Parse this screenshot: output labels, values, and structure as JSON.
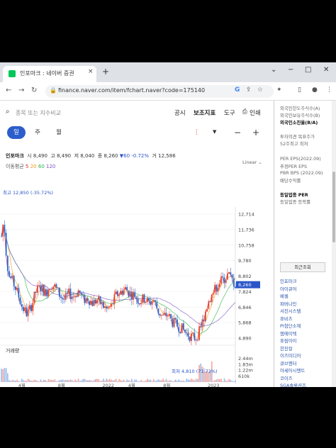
{
  "browser": {
    "tab_title": "인포마크 : 네이버 증권",
    "tab_close": "×",
    "new_tab": "+",
    "url": "finance.naver.com/item/fchart.naver?code=175140",
    "controls": [
      "−",
      "□",
      "✕"
    ]
  },
  "nav": {
    "search_placeholder": "종목 또는 지수비교",
    "items": [
      {
        "label": "공시",
        "active": false
      },
      {
        "label": "보조지표",
        "active": true
      },
      {
        "label": "도구",
        "active": false
      },
      {
        "label": "인쇄",
        "active": false
      }
    ]
  },
  "periods": [
    {
      "label": "일",
      "active": true
    },
    {
      "label": "주",
      "active": false
    },
    {
      "label": "월",
      "active": false
    }
  ],
  "zoom": {
    "minus": "−",
    "plus": "+"
  },
  "stock": {
    "name": "인포마크",
    "open_label": "시",
    "open": "8,490",
    "high_label": "고",
    "high": "8,490",
    "low_label": "저",
    "low": "8,040",
    "close_label": "종",
    "close": "8,260",
    "change": "▼60 -0.72%",
    "volume_label": "거",
    "volume": "12,586"
  },
  "moving_avg": {
    "label": "이동평균",
    "periods": [
      "5",
      "20",
      "60",
      "120"
    ]
  },
  "scale_mode": "Linear",
  "chart_data": {
    "type": "candlestick",
    "price_axis_ticks": [
      "12,714",
      "11,736",
      "10,758",
      "9,780",
      "8,802",
      "7,824",
      "6,846",
      "5,868",
      "4,890"
    ],
    "current_price_label": "8,260",
    "max_annotation": "최고 12,850 (-35.72%)",
    "min_annotation": "최저 4,810 (71.72%)",
    "volume_title": "거래량",
    "volume_ticks": [
      "2.44m",
      "1.83m",
      "1.22m",
      "610k"
    ],
    "x_ticks": [
      "4월",
      "8월",
      "2022",
      "4월",
      "8월",
      "2023"
    ],
    "ylim": [
      4890,
      12714
    ],
    "price_series": [
      {
        "t": 0.0,
        "close": 11300,
        "open": 12200
      },
      {
        "t": 0.01,
        "close": 12400,
        "open": 11300
      },
      {
        "t": 0.02,
        "close": 10300,
        "open": 12400
      },
      {
        "t": 0.03,
        "close": 8900,
        "open": 10300
      },
      {
        "t": 0.05,
        "close": 8400,
        "open": 8900
      },
      {
        "t": 0.07,
        "close": 7700,
        "open": 8400
      },
      {
        "t": 0.09,
        "close": 6800,
        "open": 7700
      },
      {
        "t": 0.11,
        "close": 6400,
        "open": 6800
      },
      {
        "t": 0.13,
        "close": 7000,
        "open": 6400
      },
      {
        "t": 0.15,
        "close": 7900,
        "open": 7000
      },
      {
        "t": 0.17,
        "close": 8100,
        "open": 7900
      },
      {
        "t": 0.19,
        "close": 7700,
        "open": 8100
      },
      {
        "t": 0.21,
        "close": 8300,
        "open": 7700
      },
      {
        "t": 0.23,
        "close": 8100,
        "open": 8300
      },
      {
        "t": 0.25,
        "close": 7600,
        "open": 8100
      },
      {
        "t": 0.27,
        "close": 7300,
        "open": 7600
      },
      {
        "t": 0.29,
        "close": 7700,
        "open": 7300
      },
      {
        "t": 0.31,
        "close": 7500,
        "open": 7700
      },
      {
        "t": 0.33,
        "close": 7900,
        "open": 7500
      },
      {
        "t": 0.35,
        "close": 7300,
        "open": 7900
      },
      {
        "t": 0.37,
        "close": 7400,
        "open": 7300
      },
      {
        "t": 0.39,
        "close": 7100,
        "open": 7400
      },
      {
        "t": 0.41,
        "close": 7300,
        "open": 7100
      },
      {
        "t": 0.43,
        "close": 7000,
        "open": 7300
      },
      {
        "t": 0.45,
        "close": 6700,
        "open": 7000
      },
      {
        "t": 0.47,
        "close": 6900,
        "open": 6700
      },
      {
        "t": 0.49,
        "close": 7600,
        "open": 6900
      },
      {
        "t": 0.51,
        "close": 7800,
        "open": 7600
      },
      {
        "t": 0.53,
        "close": 8000,
        "open": 7800
      },
      {
        "t": 0.55,
        "close": 7700,
        "open": 8000
      },
      {
        "t": 0.57,
        "close": 7600,
        "open": 7700
      },
      {
        "t": 0.59,
        "close": 7200,
        "open": 7600
      },
      {
        "t": 0.61,
        "close": 7400,
        "open": 7200
      },
      {
        "t": 0.63,
        "close": 7100,
        "open": 7400
      },
      {
        "t": 0.65,
        "close": 7300,
        "open": 7100
      },
      {
        "t": 0.67,
        "close": 6600,
        "open": 7300
      },
      {
        "t": 0.69,
        "close": 6200,
        "open": 6600
      },
      {
        "t": 0.71,
        "close": 6400,
        "open": 6200
      },
      {
        "t": 0.73,
        "close": 5900,
        "open": 6400
      },
      {
        "t": 0.75,
        "close": 5700,
        "open": 5900
      },
      {
        "t": 0.77,
        "close": 5500,
        "open": 5700
      },
      {
        "t": 0.79,
        "close": 5200,
        "open": 5500
      },
      {
        "t": 0.81,
        "close": 5000,
        "open": 5200
      },
      {
        "t": 0.83,
        "close": 4900,
        "open": 5000
      },
      {
        "t": 0.85,
        "close": 5400,
        "open": 4900
      },
      {
        "t": 0.87,
        "close": 6500,
        "open": 5400
      },
      {
        "t": 0.89,
        "close": 7400,
        "open": 6500
      },
      {
        "t": 0.91,
        "close": 7900,
        "open": 7400
      },
      {
        "t": 0.93,
        "close": 8400,
        "open": 7900
      },
      {
        "t": 0.95,
        "close": 8600,
        "open": 8400
      },
      {
        "t": 0.97,
        "close": 8900,
        "open": 8600
      },
      {
        "t": 1.0,
        "close": 8260,
        "open": 8900
      }
    ]
  },
  "sidebar": {
    "lines": [
      {
        "text": "외국인한도주식수(A)",
        "style": "gray"
      },
      {
        "text": "외국인보유주식수(B)",
        "style": "gray"
      },
      {
        "text": "외국인소진율(B/A)",
        "style": "bold"
      },
      {
        "text": "투자의견   목표주가",
        "style": "gray"
      },
      {
        "text": "52주최고   최저",
        "style": "gray"
      },
      {
        "text": "PER   EPS(2022.09)",
        "style": "gray"
      },
      {
        "text": "추정PER   EPS",
        "style": "gray"
      },
      {
        "text": "PBR   BPS (2022.09)",
        "style": "gray"
      },
      {
        "text": "배당수익률",
        "style": "gray"
      },
      {
        "text": "동일업종 PER",
        "style": "bold"
      },
      {
        "text": "동일업종 등락률",
        "style": "gray"
      }
    ],
    "recent_button": "최근조회",
    "recent": [
      "인포마크",
      "아이큐어",
      "베셀",
      "파버나인",
      "서진시스템",
      "휴비츠",
      "PI첨단소재",
      "엠에이텍",
      "휴림아이",
      "한진칼",
      "이즈미디어",
      "큐브엔터",
      "아세아시멘트",
      "코이즈",
      "SGA솔루션즈"
    ]
  }
}
